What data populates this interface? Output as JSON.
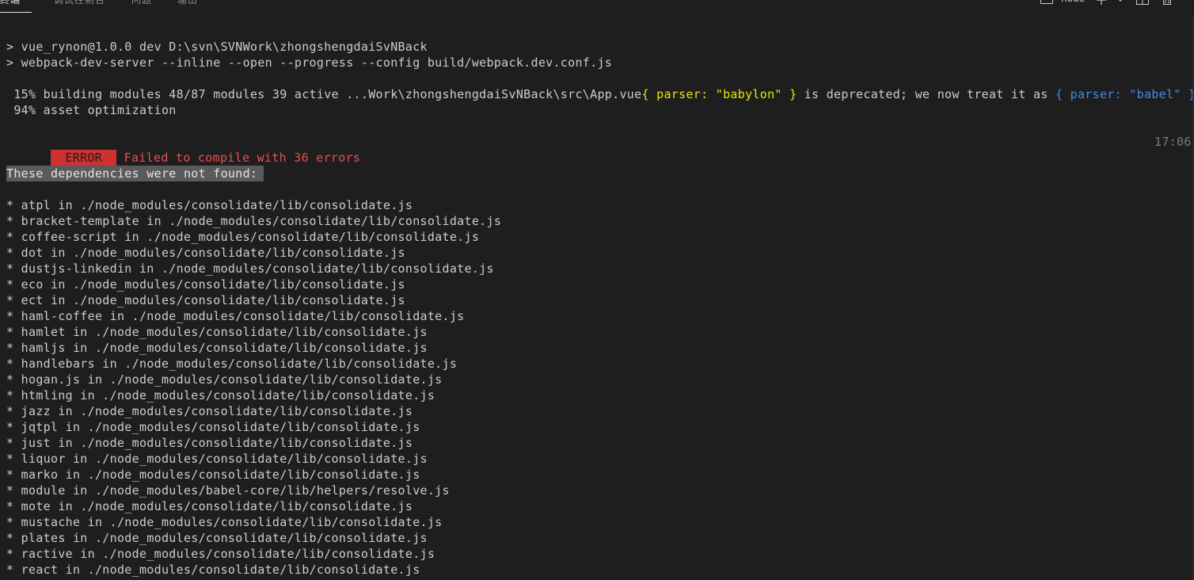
{
  "tabs": [
    {
      "label": "终端",
      "active": true
    },
    {
      "label": "调试控制台",
      "active": false
    },
    {
      "label": "问题",
      "active": false
    },
    {
      "label": "输出",
      "active": false
    }
  ],
  "terminal_selector": "node",
  "toolbar_icons": [
    "add-terminal-icon",
    "chevron-down-icon",
    "split-terminal-icon",
    "trash-icon"
  ],
  "output": {
    "cmd1": "> vue_rynon@1.0.0 dev D:\\svn\\SVNWork\\zhongshengdaiSvNBack",
    "cmd2": "> webpack-dev-server --inline --open --progress --config build/webpack.dev.conf.js",
    "progress_prefix": " 15% building modules 48/87 modules 39 active ...Work\\zhongshengdaiSvNBack\\src\\App.vue",
    "parser_old": "{ parser: \"babylon\" }",
    "deprecated_text": " is deprecated; we now treat it as ",
    "parser_new": "{ parser: \"babel\" }",
    "period": ".",
    "progress2": " 94% asset optimization",
    "error_badge": " ERROR ",
    "error_message": "Failed to compile with 36 errors",
    "timestamp": "17:06:",
    "deps_header": "These dependencies were not found:",
    "missing": [
      "* atpl in ./node_modules/consolidate/lib/consolidate.js",
      "* bracket-template in ./node_modules/consolidate/lib/consolidate.js",
      "* coffee-script in ./node_modules/consolidate/lib/consolidate.js",
      "* dot in ./node_modules/consolidate/lib/consolidate.js",
      "* dustjs-linkedin in ./node_modules/consolidate/lib/consolidate.js",
      "* eco in ./node_modules/consolidate/lib/consolidate.js",
      "* ect in ./node_modules/consolidate/lib/consolidate.js",
      "* haml-coffee in ./node_modules/consolidate/lib/consolidate.js",
      "* hamlet in ./node_modules/consolidate/lib/consolidate.js",
      "* hamljs in ./node_modules/consolidate/lib/consolidate.js",
      "* handlebars in ./node_modules/consolidate/lib/consolidate.js",
      "* hogan.js in ./node_modules/consolidate/lib/consolidate.js",
      "* htmling in ./node_modules/consolidate/lib/consolidate.js",
      "* jazz in ./node_modules/consolidate/lib/consolidate.js",
      "* jqtpl in ./node_modules/consolidate/lib/consolidate.js",
      "* just in ./node_modules/consolidate/lib/consolidate.js",
      "* liquor in ./node_modules/consolidate/lib/consolidate.js",
      "* marko in ./node_modules/consolidate/lib/consolidate.js",
      "* module in ./node_modules/babel-core/lib/helpers/resolve.js",
      "* mote in ./node_modules/consolidate/lib/consolidate.js",
      "* mustache in ./node_modules/consolidate/lib/consolidate.js",
      "* plates in ./node_modules/consolidate/lib/consolidate.js",
      "* ractive in ./node_modules/consolidate/lib/consolidate.js",
      "* react in ./node_modules/consolidate/lib/consolidate.js"
    ]
  },
  "colors": {
    "background": "#1e1e1e",
    "foreground": "#cccccc",
    "yellow": "#e5e510",
    "blue": "#3b8eea",
    "error_red": "#cd3131",
    "error_text": "#f14c4c"
  }
}
